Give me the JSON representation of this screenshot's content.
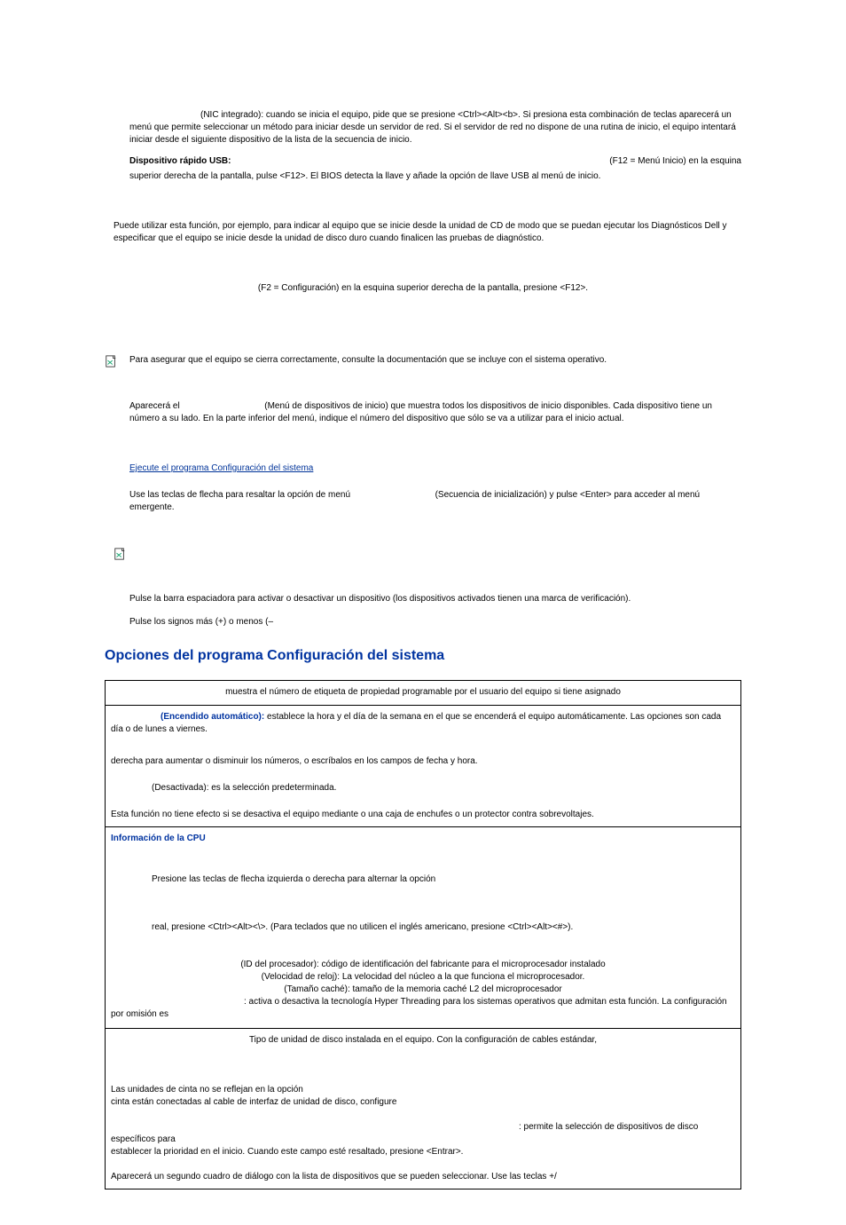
{
  "top": {
    "nic": "(NIC integrado): cuando se inicia el equipo, pide que se presione <Ctrl><Alt><b>. Si presiona esta combinación de teclas aparecerá un menú que permite seleccionar un método para iniciar desde un servidor de red. Si el servidor de red no dispone de una rutina de inicio, el equipo intentará iniciar desde el siguiente dispositivo de la lista de la secuencia de inicio.",
    "usb_label": "Dispositivo rápido USB:",
    "usb_right": "(F12 = Menú Inicio) en la esquina",
    "usb_cont": "superior derecha de la pantalla, pulse <F12>. El BIOS detecta la llave y añade la opción de llave USB al menú de inicio."
  },
  "mid": {
    "diag": "Puede utilizar esta función, por ejemplo, para indicar al equipo que se inicie desde la unidad de CD de modo que se puedan ejecutar los Diagnósticos Dell y especificar que el equipo se inicie desde la unidad de disco duro cuando finalicen las pruebas de diagnóstico.",
    "f2": "(F2 = Configuración) en la esquina superior derecha de la pantalla, presione <F12>.",
    "note1": "Para asegurar que el equipo se cierra correctamente, consulte la documentación que se incluye con el sistema operativo.",
    "bootmenu_a": "Aparecerá el",
    "bootmenu_b": "(Menú de dispositivos de inicio) que muestra todos los dispositivos de inicio disponibles. Cada dispositivo tiene un número a su lado. En la parte inferior del menú, indique el número del dispositivo que sólo se va a utilizar para el inicio actual.",
    "link": "Ejecute el programa Configuración del sistema",
    "arrows_left": "Use las teclas de flecha para resaltar la opción de menú",
    "arrows_right": "(Secuencia de inicialización) y pulse <Enter> para acceder al menú emergente.",
    "space": "Pulse la barra espaciadora para activar o desactivar un dispositivo (los dispositivos activados tienen una marca de verificación).",
    "plusminus": "Pulse los signos más (+) o menos (–"
  },
  "heading": "Opciones del programa Configuración del sistema",
  "table": {
    "r1": "muestra el número de etiqueta de propiedad programable por el usuario del equipo si tiene asignado",
    "r2_label": "(Encendido automático):",
    "r2_a": " establece la hora y el día de la semana en el que se encenderá el equipo automáticamente. Las opciones son cada día o de lunes a viernes.",
    "r2_b": "derecha para aumentar o disminuir los números, o escríbalos en los campos de fecha y hora.",
    "r2_c": "(Desactivada): es la selección predeterminada.",
    "r2_d": "Esta función no tiene efecto si se desactiva el equipo mediante o una caja de enchufes o un protector contra sobrevoltajes.",
    "cpu_head": "Información de la CPU",
    "cpu_a": "Presione las teclas de flecha izquierda o derecha para alternar la opción",
    "cpu_b": "real, presione <Ctrl><Alt><\\>. (Para teclados que no utilicen el inglés americano, presione <Ctrl><Alt><#>).",
    "cpu_c1": "(ID del procesador): código de identificación del fabricante para el microprocesador instalado",
    "cpu_c2": "(Velocidad de reloj): La velocidad del núcleo a la que funciona el microprocesador.",
    "cpu_c3": "(Tamaño caché): tamaño de la memoria caché L2 del microprocesador",
    "cpu_c4": ": activa o desactiva la tecnología Hyper Threading para los sistemas operativos que admitan esta función. La configuración por omisión es",
    "disk_a": "Tipo de unidad de disco instalada en el equipo. Con la configuración de cables estándar,",
    "disk_b1": "Las unidades de cinta no se reflejan en la opción",
    "disk_b2": "cinta están conectadas al cable de interfaz de unidad de disco, configure",
    "disk_c1": ": permite la selección de dispositivos de disco específicos para",
    "disk_c2": "establecer la prioridad en el inicio. Cuando este campo esté resaltado, presione <Entrar>.",
    "disk_d": "Aparecerá un segundo cuadro de diálogo con la lista de dispositivos que se pueden seleccionar. Use las teclas +/"
  }
}
